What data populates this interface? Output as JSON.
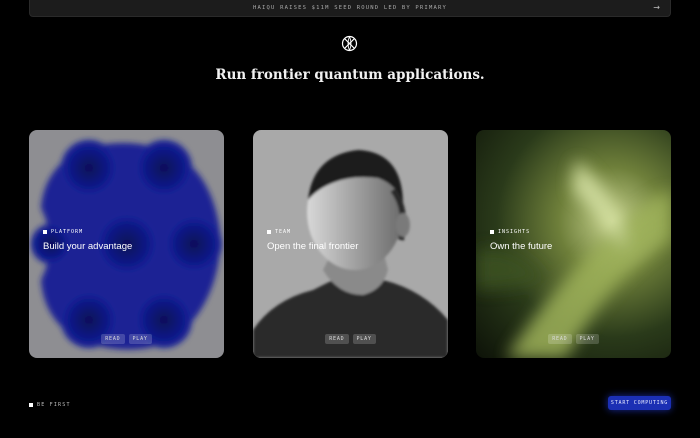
{
  "announcement": {
    "text": "HAIQU RAISES $11M SEED ROUND LED BY PRIMARY",
    "arrow": "→"
  },
  "logo": {
    "icon": "quantum-logo-icon"
  },
  "headline": "Run frontier quantum applications.",
  "cards": [
    {
      "tag": "PLATFORM",
      "title": "Build your advantage",
      "chips": [
        "READ",
        "PLAY"
      ],
      "art": "blue-orb-molecule"
    },
    {
      "tag": "TEAM",
      "title": "Open the final frontier",
      "chips": [
        "READ",
        "PLAY"
      ],
      "art": "grayscale-portrait"
    },
    {
      "tag": "INSIGHTS",
      "title": "Own the future",
      "chips": [
        "READ",
        "PLAY"
      ],
      "art": "blurred-green-plant"
    }
  ],
  "footer": {
    "be_first": "BE FIRST",
    "cta": "START COMPUTING"
  },
  "colors": {
    "background": "#000000",
    "accent": "#1b2fb4",
    "announce_bg": "#1c1c1c"
  }
}
